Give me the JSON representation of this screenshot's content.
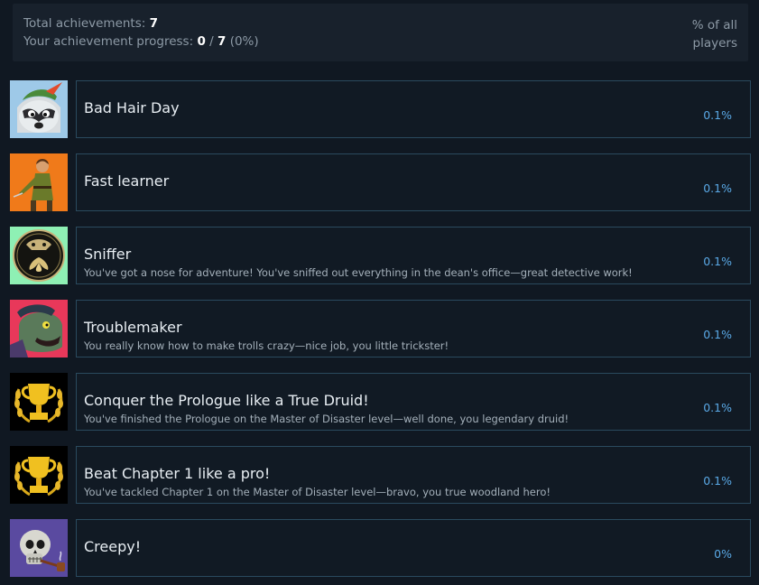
{
  "summary": {
    "total_label": "Total achievements:",
    "total_value": "7",
    "progress_label": "Your achievement progress:",
    "progress_current": "0",
    "progress_sep": "/",
    "progress_total": "7",
    "progress_pct": "(0%)",
    "column_header": "% of all players"
  },
  "achievements": [
    {
      "title": "Bad Hair Day",
      "description": "",
      "percent": "0.1%",
      "icon": "raccoon-hat-icon",
      "bg": "#9ec9e8"
    },
    {
      "title": "Fast learner",
      "description": "",
      "percent": "0.1%",
      "icon": "archer-icon",
      "bg": "#f07a1a"
    },
    {
      "title": "Sniffer",
      "description": "You've got a nose for adventure! You've sniffed out everything in the dean's office—great detective work!",
      "percent": "0.1%",
      "icon": "mole-badge-icon",
      "bg": "#8ef0b4"
    },
    {
      "title": "Troublemaker",
      "description": "You really know how to make trolls crazy—nice job, you little trickster!",
      "percent": "0.1%",
      "icon": "troll-icon",
      "bg": "#e8385a"
    },
    {
      "title": "Conquer the Prologue like a True Druid!",
      "description": "You've finished the Prologue on the Master of Disaster level—well done, you legendary druid!",
      "percent": "0.1%",
      "icon": "trophy-icon",
      "bg": "#000000"
    },
    {
      "title": "Beat Chapter 1 like a pro!",
      "description": "You've tackled Chapter 1 on the Master of Disaster level—bravo, you true woodland hero!",
      "percent": "0.1%",
      "icon": "trophy-icon",
      "bg": "#000000"
    },
    {
      "title": "Creepy!",
      "description": "",
      "percent": "0%",
      "icon": "skull-pipe-icon",
      "bg": "#5a4aa0"
    }
  ]
}
